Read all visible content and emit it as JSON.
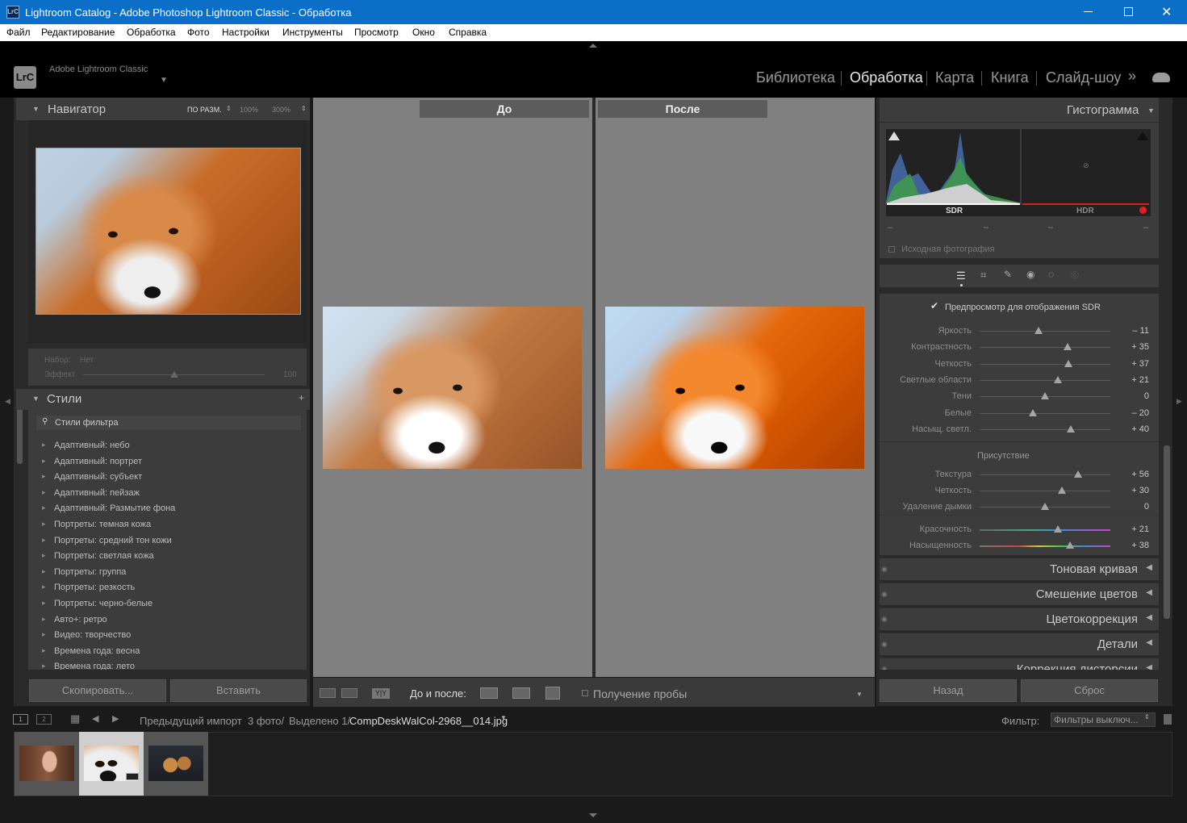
{
  "window": {
    "title": "Lightroom Catalog - Adobe Photoshop Lightroom Classic - Обработка",
    "app_icon": "LrC"
  },
  "menu": [
    "Файл",
    "Редактирование",
    "Обработка",
    "Фото",
    "Настройки",
    "Инструменты",
    "Просмотр",
    "Окно",
    "Справка"
  ],
  "identity": {
    "logo": "LrC",
    "app_name": "Adobe Lightroom Classic"
  },
  "modules": [
    {
      "label": "Библиотека",
      "active": false
    },
    {
      "label": "Обработка",
      "active": true
    },
    {
      "label": "Карта",
      "active": false
    },
    {
      "label": "Книга",
      "active": false
    },
    {
      "label": "Слайд-шоу",
      "active": false
    }
  ],
  "navigator": {
    "title": "Навигатор",
    "zoom": [
      "ПО РАЗМ.",
      "100%",
      "300%"
    ]
  },
  "preset_bar": {
    "set_label": "Набор:",
    "set_value": "Нет",
    "effect_label": "Эффект",
    "effect_value": "100"
  },
  "presets": {
    "title": "Стили",
    "add": "+",
    "search": "Стили фильтра",
    "items": [
      "Адаптивный: небо",
      "Адаптивный: портрет",
      "Адаптивный: субъект",
      "Адаптивный: пейзаж",
      "Адаптивный: Размытие фона",
      "Портреты: темная кожа",
      "Портреты: средний тон кожи",
      "Портреты: светлая кожа",
      "Портреты: группа",
      "Портреты: резкость",
      "Портреты: черно-белые",
      "Авто+: ретро",
      "Видео: творчество",
      "Времена года: весна",
      "Времена года: лето"
    ]
  },
  "left_buttons": {
    "copy": "Скопировать...",
    "paste": "Вставить"
  },
  "compare": {
    "before": "До",
    "after": "После"
  },
  "toolbar": {
    "before_after": "До и после:",
    "softproof": "Получение пробы",
    "yy": "Y|Y"
  },
  "histogram": {
    "title": "Гистограмма",
    "sdr": "SDR",
    "hdr": "HDR",
    "readouts": [
      "–",
      "–",
      "–",
      "–"
    ],
    "original": "Исходная фотография"
  },
  "basic": {
    "sdr_preview": "Предпросмотр для отображения SDR",
    "presence": "Присутствие",
    "tone": [
      {
        "label": "Яркость",
        "value": "– 11",
        "pos": 0.45
      },
      {
        "label": "Контрастность",
        "value": "+ 35",
        "pos": 0.67
      },
      {
        "label": "Четкость",
        "value": "+ 37",
        "pos": 0.68
      },
      {
        "label": "Светлые области",
        "value": "+ 21",
        "pos": 0.6
      },
      {
        "label": "Тени",
        "value": "0",
        "pos": 0.5
      },
      {
        "label": "Белые",
        "value": "– 20",
        "pos": 0.41
      },
      {
        "label": "Насыщ. светл.",
        "value": "+ 40",
        "pos": 0.7
      }
    ],
    "presence_sliders": [
      {
        "label": "Текстура",
        "value": "+ 56",
        "pos": 0.75
      },
      {
        "label": "Четкость",
        "value": "+ 30",
        "pos": 0.63
      },
      {
        "label": "Удаление дымки",
        "value": "0",
        "pos": 0.5
      }
    ],
    "color_sliders": [
      {
        "label": "Красочность",
        "value": "+ 21",
        "pos": 0.6
      },
      {
        "label": "Насыщенность",
        "value": "+ 38",
        "pos": 0.69
      }
    ]
  },
  "right_panels": [
    "Тоновая кривая",
    "Смешение цветов",
    "Цветокоррекция",
    "Детали",
    "Коррекция дисторсии"
  ],
  "right_buttons": {
    "prev": "Назад",
    "reset": "Сброс"
  },
  "filmstrip": {
    "source": "Предыдущий импорт",
    "count": "3 фото/",
    "selected": "Выделено 1/",
    "filename": "CompDeskWalCol-2968__014.jpg",
    "filter_label": "Фильтр:",
    "filter_value": "Фильтры выключ..."
  },
  "colors": {
    "accent": "#0b6ec7",
    "panel": "#3c3c3c",
    "bg": "#1a1a1a",
    "canvas": "#808080"
  }
}
